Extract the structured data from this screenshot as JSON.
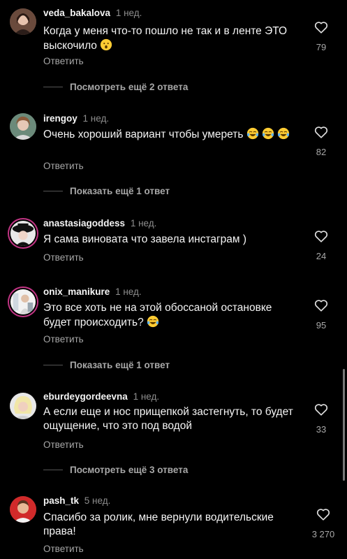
{
  "comments": [
    {
      "user": "veda_bakalova",
      "time": "1 нед.",
      "text": "Когда у меня что-то пошло не так и в ленте ЭТО выскочило",
      "emoji": "hushed",
      "likes": "79",
      "reply": "Ответить",
      "more": "Посмотреть ещё 2 ответа"
    },
    {
      "user": "irengoy",
      "time": "1 нед.",
      "text": "Очень хороший вариант чтобы умереть",
      "emoji": "joy",
      "likes": "82",
      "reply": "Ответить",
      "more": "Показать ещё 1 ответ"
    },
    {
      "user": "anastasiagoddess",
      "time": "1 нед.",
      "text": "Я сама виновата что завела инстаграм )",
      "likes": "24",
      "reply": "Ответить"
    },
    {
      "user": "onix_manikure",
      "time": "1 нед.",
      "text": "Это все хоть не на этой обоссаной остановке будет происходить?",
      "emoji": "joy",
      "likes": "95",
      "reply": "Ответить",
      "more": "Показать ещё 1 ответ"
    },
    {
      "user": "eburdeygordeevna",
      "time": "1 нед.",
      "text": "А если еще и нос прищепкой застегнуть, то будет ощущение, что это под водой",
      "likes": "33",
      "reply": "Ответить",
      "more": "Посмотреть ещё 3 ответа"
    },
    {
      "user": "pash_tk",
      "time": "5 нед.",
      "text": "Спасибо за ролик, мне вернули водительские права!",
      "likes": "3 270",
      "reply": "Ответить"
    }
  ],
  "colors": {
    "background": "#000000",
    "text": "#f5f5f5",
    "secondary": "#a8a8a8",
    "muted": "#8e8e8e",
    "story_ring": "#c13584"
  },
  "icons": {
    "like": "heart-outline-icon",
    "hushed": "hushed-face-emoji",
    "joy": "face-with-tears-of-joy-emoji"
  }
}
